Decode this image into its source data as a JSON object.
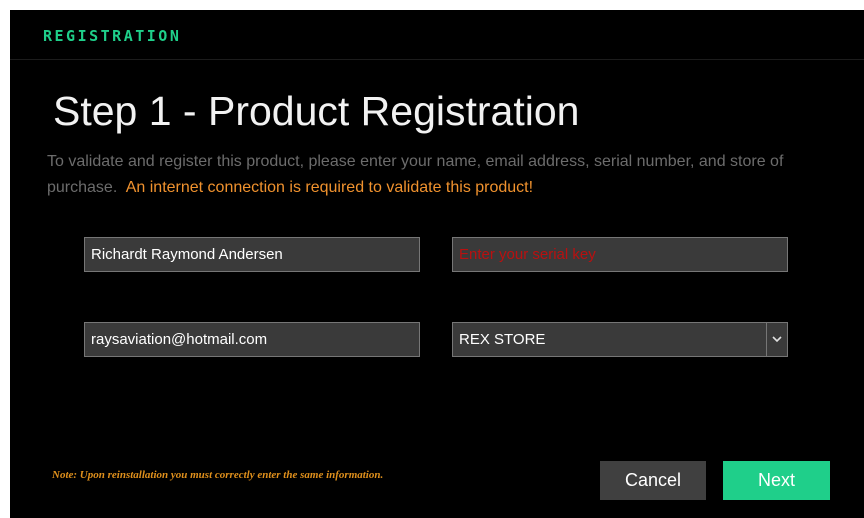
{
  "app": {
    "brand": "REGISTRATION"
  },
  "page": {
    "heading": "Step 1 - Product Registration",
    "description": "To validate and register this product, please enter your name, email address, serial number, and store of purchase.",
    "warning": "An internet connection is required to validate this product!",
    "note": "Note: Upon reinstallation you must correctly enter the same information."
  },
  "form": {
    "name_value": "Richardt Raymond Andersen",
    "serial_placeholder": "Enter your serial key",
    "email_value": "raysaviation@hotmail.com",
    "store_selected": "REX STORE"
  },
  "buttons": {
    "cancel": "Cancel",
    "next": "Next"
  },
  "colors": {
    "accent": "#1fcf8a",
    "warning": "#f0922e",
    "placeholder": "#b91010",
    "background": "#000000"
  },
  "icons": {
    "store_dropdown": "chevron-down-icon"
  }
}
